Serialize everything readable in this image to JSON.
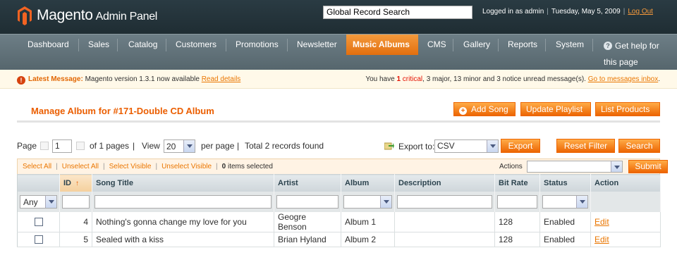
{
  "header": {
    "logo_text": "Magento",
    "logo_sub": "Admin Panel",
    "search_value": "Global Record Search",
    "logged_in": "Logged in as admin",
    "date": "Tuesday, May 5, 2009",
    "logout": "Log Out"
  },
  "nav": {
    "items": [
      "Dashboard",
      "Sales",
      "Catalog",
      "Customers",
      "Promotions",
      "Newsletter",
      "Music Albums",
      "CMS",
      "Gallery",
      "Reports",
      "System"
    ],
    "active": "Music Albums",
    "help": "Get help for this page"
  },
  "message": {
    "title": "Latest Message:",
    "text": "Magento version 1.3.1 now available",
    "link": "Read details",
    "right_prefix": "You have",
    "critical_count": "1",
    "critical_label": "critical",
    "rest": ", 3 major, 13 minor and 3 notice unread message(s).",
    "inbox_link": "Go to messages inbox"
  },
  "page": {
    "title": "Manage Album for #171-Double CD Album",
    "buttons": {
      "add_song": "Add Song",
      "update_playlist": "Update Playlist",
      "list_products": "List Products"
    }
  },
  "pager": {
    "page_label": "Page",
    "page_value": "1",
    "of_pages": "of 1 pages",
    "view_label": "View",
    "per_page_value": "20",
    "per_page_label": "per page",
    "total": "Total 2 records found",
    "sep": "|"
  },
  "export": {
    "label": "Export to:",
    "format": "CSV",
    "button": "Export"
  },
  "filters": {
    "reset": "Reset Filter",
    "search": "Search"
  },
  "massaction": {
    "select_all": "Select All",
    "unselect_all": "Unselect All",
    "select_visible": "Select Visible",
    "unselect_visible": "Unselect Visible",
    "selected_count": "0",
    "selected_label": "items selected",
    "actions_label": "Actions",
    "submit": "Submit"
  },
  "grid": {
    "columns": [
      "ID",
      "Song Title",
      "Artist",
      "Album",
      "Description",
      "Bit Rate",
      "Status",
      "Action"
    ],
    "any_filter": "Any",
    "rows": [
      {
        "id": "4",
        "title": "Nothing's gonna change my love for you",
        "artist": "Geogre Benson",
        "album": "Album 1",
        "description": "",
        "bitrate": "128",
        "status": "Enabled",
        "action": "Edit"
      },
      {
        "id": "5",
        "title": "Sealed with a kiss",
        "artist": "Brian Hyland",
        "album": "Album 2",
        "description": "",
        "bitrate": "128",
        "status": "Enabled",
        "action": "Edit"
      }
    ]
  },
  "colors": {
    "accent": "#eb5e00",
    "header_bg": "#2a3b43",
    "nav_bg": "#6d7e86"
  }
}
